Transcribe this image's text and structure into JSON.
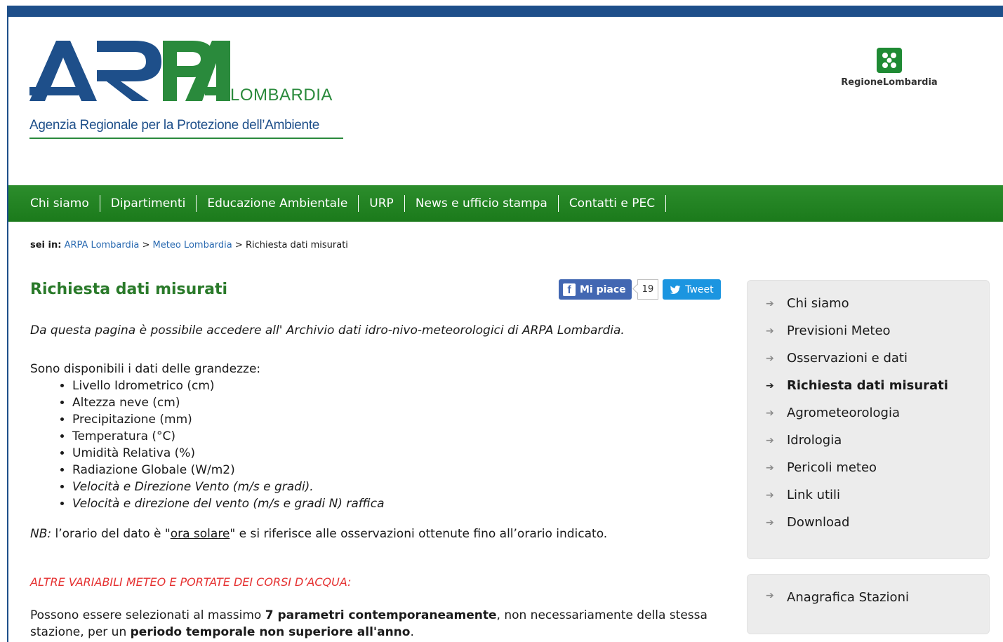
{
  "header": {
    "logo_text": "ARPA",
    "logo_region": "LOMBARDIA",
    "logo_subtitle": "Agenzia Regionale per la Protezione dell’Ambiente",
    "region_logo_text": "RegioneLombardia"
  },
  "nav": {
    "items": [
      "Chi siamo",
      "Dipartimenti",
      "Educazione Ambientale",
      "URP",
      "News e ufficio stampa",
      "Contatti e PEC"
    ]
  },
  "breadcrumb": {
    "lead": "sei in:",
    "items": [
      "ARPA Lombardia",
      "Meteo Lombardia",
      "Richiesta dati misurati"
    ],
    "separator": ">"
  },
  "page": {
    "title": "Richiesta dati misurati",
    "intro": "Da questa pagina è possibile accedere all' Archivio dati idro-nivo-meteorologici di ARPA Lombardia.",
    "available_label": "Sono disponibili i dati delle grandezze:",
    "quantities": [
      "Livello Idrometrico (cm)",
      "Altezza neve (cm)",
      "Precipitazione (mm)",
      "Temperatura (°C)",
      "Umidità Relativa (%)",
      "Radiazione Globale (W/m2)",
      "Velocità e Direzione Vento (m/s e gradi).",
      "Velocità e direzione del vento (m/s e gradi N) raffica"
    ],
    "nb_label": "NB:",
    "nb_text_before": " l’orario del dato è \"",
    "nb_link": "ora solare",
    "nb_text_after": "\" e si riferisce alle osservazioni ottenute fino all’orario indicato.",
    "alt_heading": "ALTRE VARIABILI METEO E PORTATE DEI CORSI D’ACQUA:",
    "para_1": "Possono essere selezionati al massimo ",
    "para_bold_1": "7 parametri contemporaneamente",
    "para_2": ", non necessariamente della stessa stazione, per un ",
    "para_bold_2": "periodo temporale non superiore all'anno",
    "para_3": "."
  },
  "social": {
    "fb_label": "Mi piace",
    "fb_count": "19",
    "tweet_label": "Tweet"
  },
  "sidebar": {
    "items": [
      "Chi siamo",
      "Previsioni Meteo",
      "Osservazioni e dati",
      "Richiesta dati misurati",
      "Agrometeorologia",
      "Idrologia",
      "Pericoli meteo",
      "Link utili",
      "Download"
    ],
    "active_item": "Richiesta dati misurati",
    "secondary_item": "Anagrafica Stazioni"
  },
  "colors": {
    "brand_blue": "#1e4f8a",
    "brand_green": "#2a8a3c",
    "nav_green": "#238423",
    "title_green": "#2a7a2a",
    "alert_red": "#e53030",
    "link_blue": "#2a6ab1"
  }
}
